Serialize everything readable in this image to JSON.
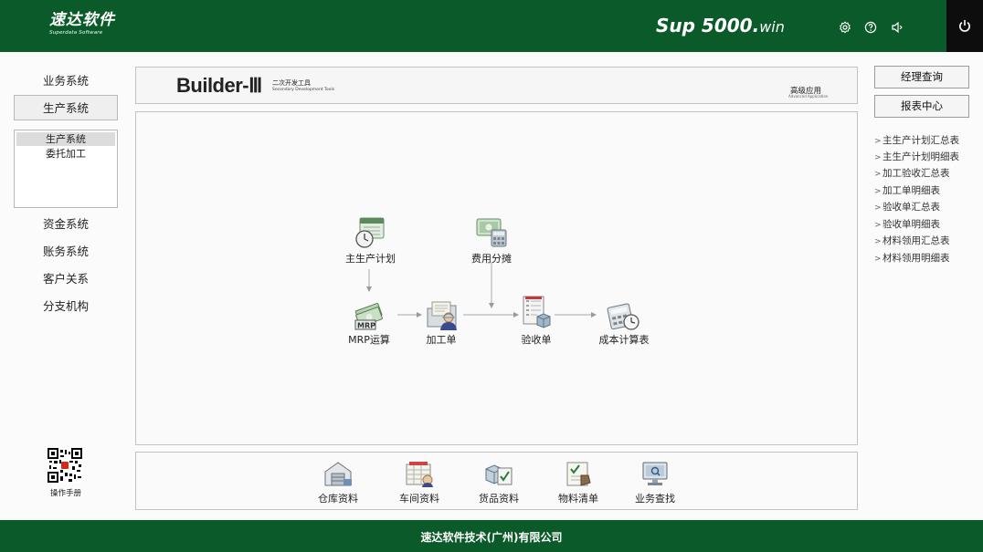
{
  "header": {
    "logo": "速达软件",
    "logo_sub": "Superdata Software",
    "brand_main": "Sup 5000.",
    "brand_suffix": "win",
    "icons": [
      "settings-icon",
      "help-icon",
      "sound-icon",
      "power-icon"
    ]
  },
  "nav": {
    "items": [
      {
        "label": "业务系统",
        "active": false
      },
      {
        "label": "生产系统",
        "active": true
      },
      {
        "label": "资金系统",
        "active": false
      },
      {
        "label": "账务系统",
        "active": false
      },
      {
        "label": "客户关系",
        "active": false
      },
      {
        "label": "分支机构",
        "active": false
      }
    ],
    "sub_items": [
      {
        "label": "生产系统",
        "selected": true
      },
      {
        "label": "委托加工",
        "selected": false
      }
    ],
    "manual_label": "操作手册"
  },
  "banner": {
    "title": "Builder-Ⅲ",
    "subtitle_cn": "二次开发工具",
    "subtitle_en": "Secondary Development Tools",
    "advanced_cn": "高级应用",
    "advanced_en": "Advanced Application"
  },
  "flow": {
    "nodes": [
      {
        "id": "main-plan",
        "label": "主生产计划",
        "icon": "calendar-clock-icon"
      },
      {
        "id": "cost-allocation",
        "label": "费用分摊",
        "icon": "cash-calculator-icon"
      },
      {
        "id": "mrp",
        "label": "MRP运算",
        "icon": "mrp-cash-icon"
      },
      {
        "id": "process-order",
        "label": "加工单",
        "icon": "worker-folder-icon"
      },
      {
        "id": "acceptance-order",
        "label": "验收单",
        "icon": "document-box-icon"
      },
      {
        "id": "cost-sheet",
        "label": "成本计算表",
        "icon": "calculator-clock-icon"
      }
    ]
  },
  "toolbar": {
    "items": [
      {
        "label": "仓库资料",
        "icon": "warehouse-icon"
      },
      {
        "label": "车间资料",
        "icon": "workshop-icon"
      },
      {
        "label": "货品资料",
        "icon": "goods-icon"
      },
      {
        "label": "物料清单",
        "icon": "material-list-icon"
      },
      {
        "label": "业务查找",
        "icon": "monitor-search-icon"
      }
    ]
  },
  "right": {
    "buttons": [
      "经理查询",
      "报表中心"
    ],
    "reports": [
      "主生产计划汇总表",
      "主生产计划明细表",
      "加工验收汇总表",
      "加工单明细表",
      "验收单汇总表",
      "验收单明细表",
      "材料领用汇总表",
      "材料领用明细表"
    ]
  },
  "footer": {
    "company": "速达软件技术(广州)有限公司"
  },
  "colors": {
    "header": "#0a5a2a",
    "footer": "#0a5a2a",
    "power_bg": "#0d0d0d",
    "border": "#c2c2c2"
  }
}
